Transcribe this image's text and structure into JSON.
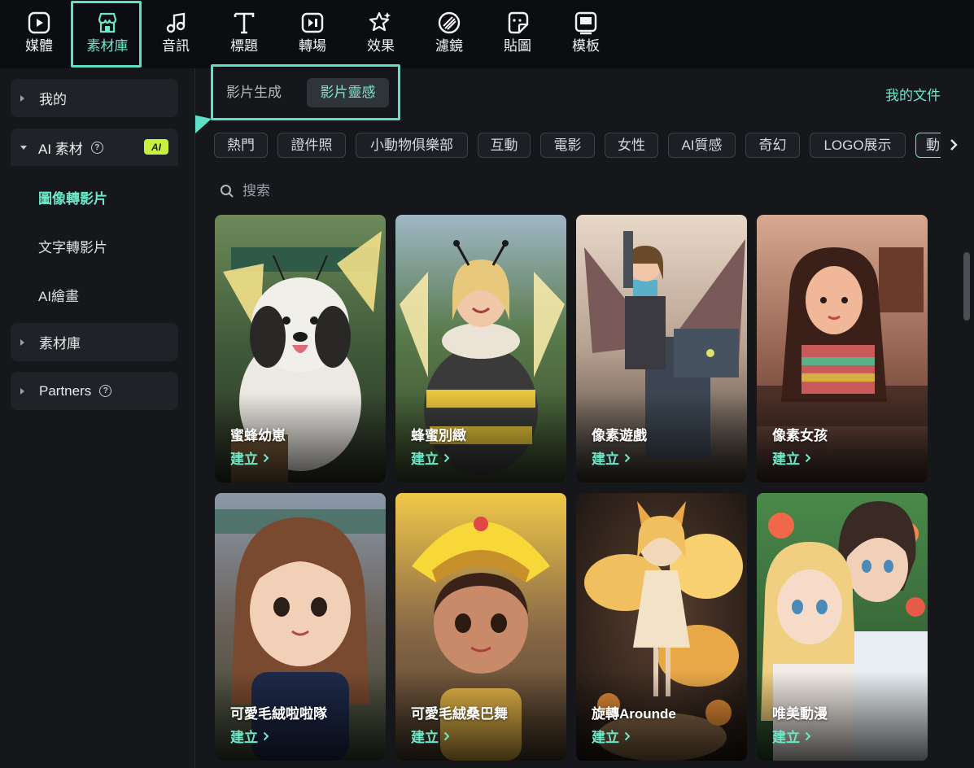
{
  "toolbar": {
    "items": [
      {
        "label": "媒體",
        "icon": "media-icon"
      },
      {
        "label": "素材庫",
        "icon": "stock-store-icon"
      },
      {
        "label": "音訊",
        "icon": "music-note-icon"
      },
      {
        "label": "標題",
        "icon": "title-t-icon"
      },
      {
        "label": "轉場",
        "icon": "transition-icon"
      },
      {
        "label": "效果",
        "icon": "effects-star-icon"
      },
      {
        "label": "濾鏡",
        "icon": "filter-icon"
      },
      {
        "label": "貼圖",
        "icon": "sticker-icon"
      },
      {
        "label": "模板",
        "icon": "template-icon"
      }
    ],
    "active_index": 1
  },
  "sidebar": {
    "mine": "我的",
    "ai_group": {
      "label": "AI 素材",
      "badge": "AI"
    },
    "ai_items": [
      "圖像轉影片",
      "文字轉影片",
      "AI繪畫"
    ],
    "stock": "素材庫",
    "partners": "Partners"
  },
  "tabs": {
    "generate": "影片生成",
    "inspiration": "影片靈感"
  },
  "my_docs": "我的文件",
  "chips": [
    "熱門",
    "證件照",
    "小動物俱樂部",
    "互動",
    "電影",
    "女性",
    "AI質感",
    "奇幻",
    "LOGO展示",
    "動"
  ],
  "search": {
    "placeholder": "搜索"
  },
  "create_label": "建立",
  "cards": [
    {
      "title": "蜜蜂幼崽"
    },
    {
      "title": "蜂蜜別緻"
    },
    {
      "title": "像素遊戲"
    },
    {
      "title": "像素女孩"
    },
    {
      "title": "可愛毛絨啦啦隊"
    },
    {
      "title": "可愛毛絨桑巴舞"
    },
    {
      "title": "旋轉Arounde"
    },
    {
      "title": "唯美動漫"
    }
  ],
  "colors": {
    "accent": "#6ee6c8",
    "highlight_annotation": "#5fe0c4",
    "ai_badge": "#c6f23d"
  }
}
